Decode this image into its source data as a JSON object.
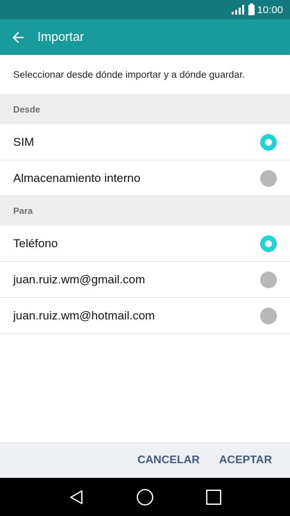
{
  "status_bar": {
    "time": "10:00"
  },
  "app_bar": {
    "title": "Importar"
  },
  "instruction": "Seleccionar desde dónde importar y a dónde guardar.",
  "source": {
    "header": "Desde",
    "options": [
      {
        "label": "SIM",
        "selected": true
      },
      {
        "label": "Almacenamiento interno",
        "selected": false
      }
    ]
  },
  "destination": {
    "header": "Para",
    "options": [
      {
        "label": "Teléfono",
        "selected": true
      },
      {
        "label": "juan.ruiz.wm@gmail.com",
        "selected": false
      },
      {
        "label": "juan.ruiz.wm@hotmail.com",
        "selected": false
      }
    ]
  },
  "buttons": {
    "cancel": "CANCELAR",
    "accept": "ACEPTAR"
  },
  "colors": {
    "status_bar": "#127a7c",
    "app_bar": "#1a9b9b",
    "radio_on": "#1fd4d8",
    "radio_off": "#b8b8b8",
    "button_text": "#3e5c80"
  }
}
